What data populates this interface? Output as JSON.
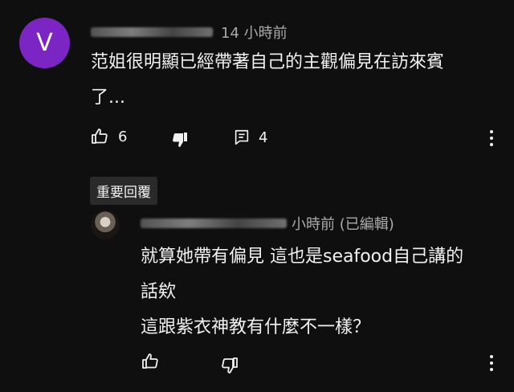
{
  "comment": {
    "avatar_letter": "V",
    "avatar_color": "#7b25c4",
    "time": "14 小時前",
    "text_line1": "范姐很明顯已經帶著自己的主觀偏見在訪來賓",
    "text_line2": "了...",
    "like_count": "6",
    "reply_count": "4"
  },
  "badge": {
    "label": "重要回覆"
  },
  "reply": {
    "time": "小時前 (已編輯)",
    "line1": "就算她帶有偏見 這也是seafood自己講的",
    "line2": "話欸",
    "line3": "這跟紫衣神教有什麼不一樣？"
  },
  "icons": [
    "thumbs-up-icon",
    "thumbs-down-icon",
    "reply-icon",
    "more-vert-icon"
  ]
}
